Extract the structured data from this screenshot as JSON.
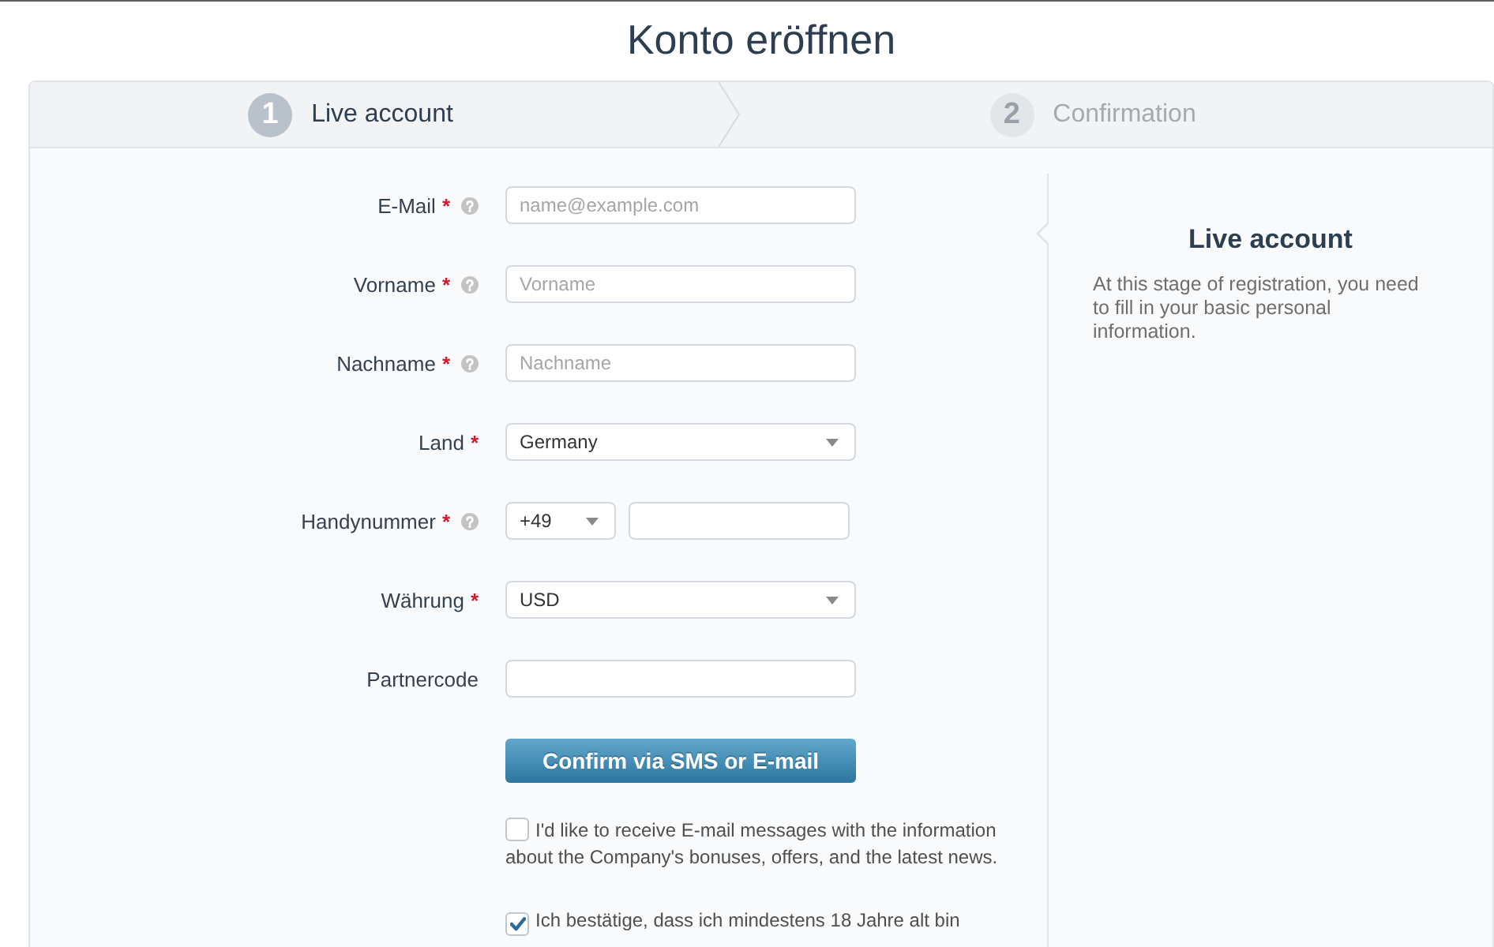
{
  "page": {
    "title": "Konto eröffnen"
  },
  "steps": [
    {
      "number": "1",
      "label": "Live account",
      "selected": true
    },
    {
      "number": "2",
      "label": "Confirmation",
      "selected": false
    }
  ],
  "form": {
    "fields": [
      {
        "kind": "text",
        "label": "E-Mail",
        "required_mark": "*",
        "help": true,
        "placeholder": "name@example.com"
      },
      {
        "kind": "text",
        "label": "Vorname",
        "required_mark": "*",
        "help": true,
        "placeholder": "Vorname"
      },
      {
        "kind": "text",
        "label": "Nachname",
        "required_mark": "*",
        "help": true,
        "placeholder": "Nachname"
      },
      {
        "kind": "select",
        "label": "Land",
        "required_mark": "*",
        "help": false,
        "value": "Germany"
      },
      {
        "kind": "phone",
        "label": "Handynummer",
        "required_mark": "*",
        "help": true,
        "code": "+49"
      },
      {
        "kind": "select",
        "label": "Währung",
        "required_mark": "*",
        "help": false,
        "value": "USD"
      },
      {
        "kind": "text",
        "label": "Partnercode",
        "help": false
      }
    ],
    "submit_button": "Confirm via SMS or E-mail",
    "checkboxes": [
      {
        "label": "I'd like to receive E-mail messages with the information about the Company's bonuses, offers, and the latest news.",
        "checked": false
      },
      {
        "label": "Ich bestätige, dass ich mindestens 18 Jahre alt bin",
        "checked": true
      }
    ]
  },
  "side_panel": {
    "title": "Live account",
    "text": "At this stage of registration, you need to fill in your basic personal information."
  }
}
